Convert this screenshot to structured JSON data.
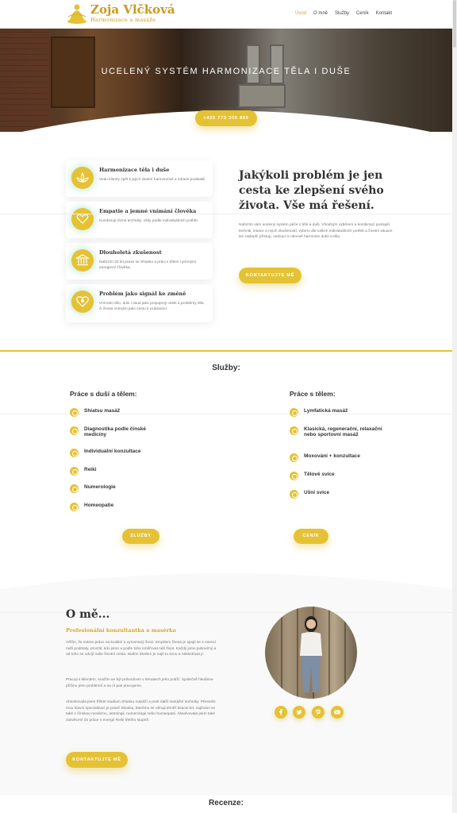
{
  "header": {
    "logo_name": "Zoja Vlčková",
    "logo_sub": "Harmonizace a masáže",
    "nav": [
      {
        "label": "Úvod",
        "active": true
      },
      {
        "label": "O mně",
        "active": false
      },
      {
        "label": "Služby",
        "active": false
      },
      {
        "label": "Ceník",
        "active": false
      },
      {
        "label": "Kontakt",
        "active": false
      }
    ]
  },
  "hero": {
    "title": "UCELENÝ SYSTÉM HARMONIZACE TĚLA I DUŠE",
    "phone_button": "+420 775 305 890"
  },
  "features": [
    {
      "title": "Harmonizace těla i duše",
      "text": "Vedu klienty zpět k jejich vlastní harmonické a zdravé podstatě.",
      "icon": "lotus-icon"
    },
    {
      "title": "Empatie a jemné vnímání člověka",
      "text": "Kombinuji různé techniky, vždy podle individuálních potřeb.",
      "icon": "heart-hand-icon"
    },
    {
      "title": "Dlouholetá zkušenost",
      "text": "Nabízím 20 let praxe se Shiatsu a práci s tělem i jemnými energiemi člověka.",
      "icon": "temple-icon"
    },
    {
      "title": "Problém jako signál ke změně",
      "text": "Vnímám tělo, duši i osud jako propojený celek a problémy těla či života vnímám jako cestu k uzdravení.",
      "icon": "heart-icon"
    }
  ],
  "intro": {
    "heading": "Jakýkoli problém je jen cesta ke zlepšení svého života. Vše má řešení.",
    "text": "Nabízím vám ucelený systém péče o tělo a duši. Vhodným výběrem a kombinací postupů, technik, intuice a mých zkušeností, vyberu dle vašich individuálních potřeb a životní situace ten nejlepší přístup, vedoucí k obnově harmonie duše a těla.",
    "button": "KONTAKTUJTE MĚ"
  },
  "services": {
    "title": "Služby:",
    "left_heading": "Práce s duší a tělem:",
    "right_heading": "Práce s tělem:",
    "left_items": [
      "Shiatsu masáž",
      "Diagnostika podle čínské medicíny",
      "Individuální konzultace",
      "Reiki",
      "Numerologie",
      "Homeopatie"
    ],
    "right_items": [
      "Lymfatická masáž",
      "Klasická, regenerační, relaxační nebo sportovní masáž",
      "Moxování + konzultace",
      "Tělové svíce",
      "Ušní svíce"
    ],
    "button_left": "SLUŽBY",
    "button_right": "CENÍK"
  },
  "about": {
    "heading": "O mě...",
    "subheading": "Profesionální konzultantka a masérka",
    "paragraphs": [
      "Věřím, že máme právo na kvalitní a vyrovnaný život. Smyslem života je spojit se s esencí naší podstaty, procítit, kdo jsme a podle toho směřovat náš život. Každý jsme jedinečný a od toho se odvíjí naše životní cesta. Naším úkolem je najít tu svou a následovat ji.",
      "Pracuji s klientem, snažím se být průvodcem v tématech jeho potíží. Společně hledáme příčinu jeho problémů a na ní pak pracujeme.",
      "Absolvovala jsem tříleté studium Shiatsu masáží a poté další masážní techniky. Přestože mou hlavní specializací je právě Shiatsu, kterému se věnuji téměř dvacet let, zajímám se také o čínskou medicínu, astrologii, numerologii nebo homeopatii. Absolvovala jsem také zasvěcení do práce s energií Reiki třetího stupně."
    ],
    "social": [
      "facebook-icon",
      "twitter-icon",
      "pinterest-icon",
      "youtube-icon"
    ],
    "button": "KONTAKTUJTE MĚ"
  },
  "reviews": {
    "title": "Recenze:"
  },
  "colors": {
    "accent": "#e5c235",
    "accent_text": "#d4a72c"
  }
}
